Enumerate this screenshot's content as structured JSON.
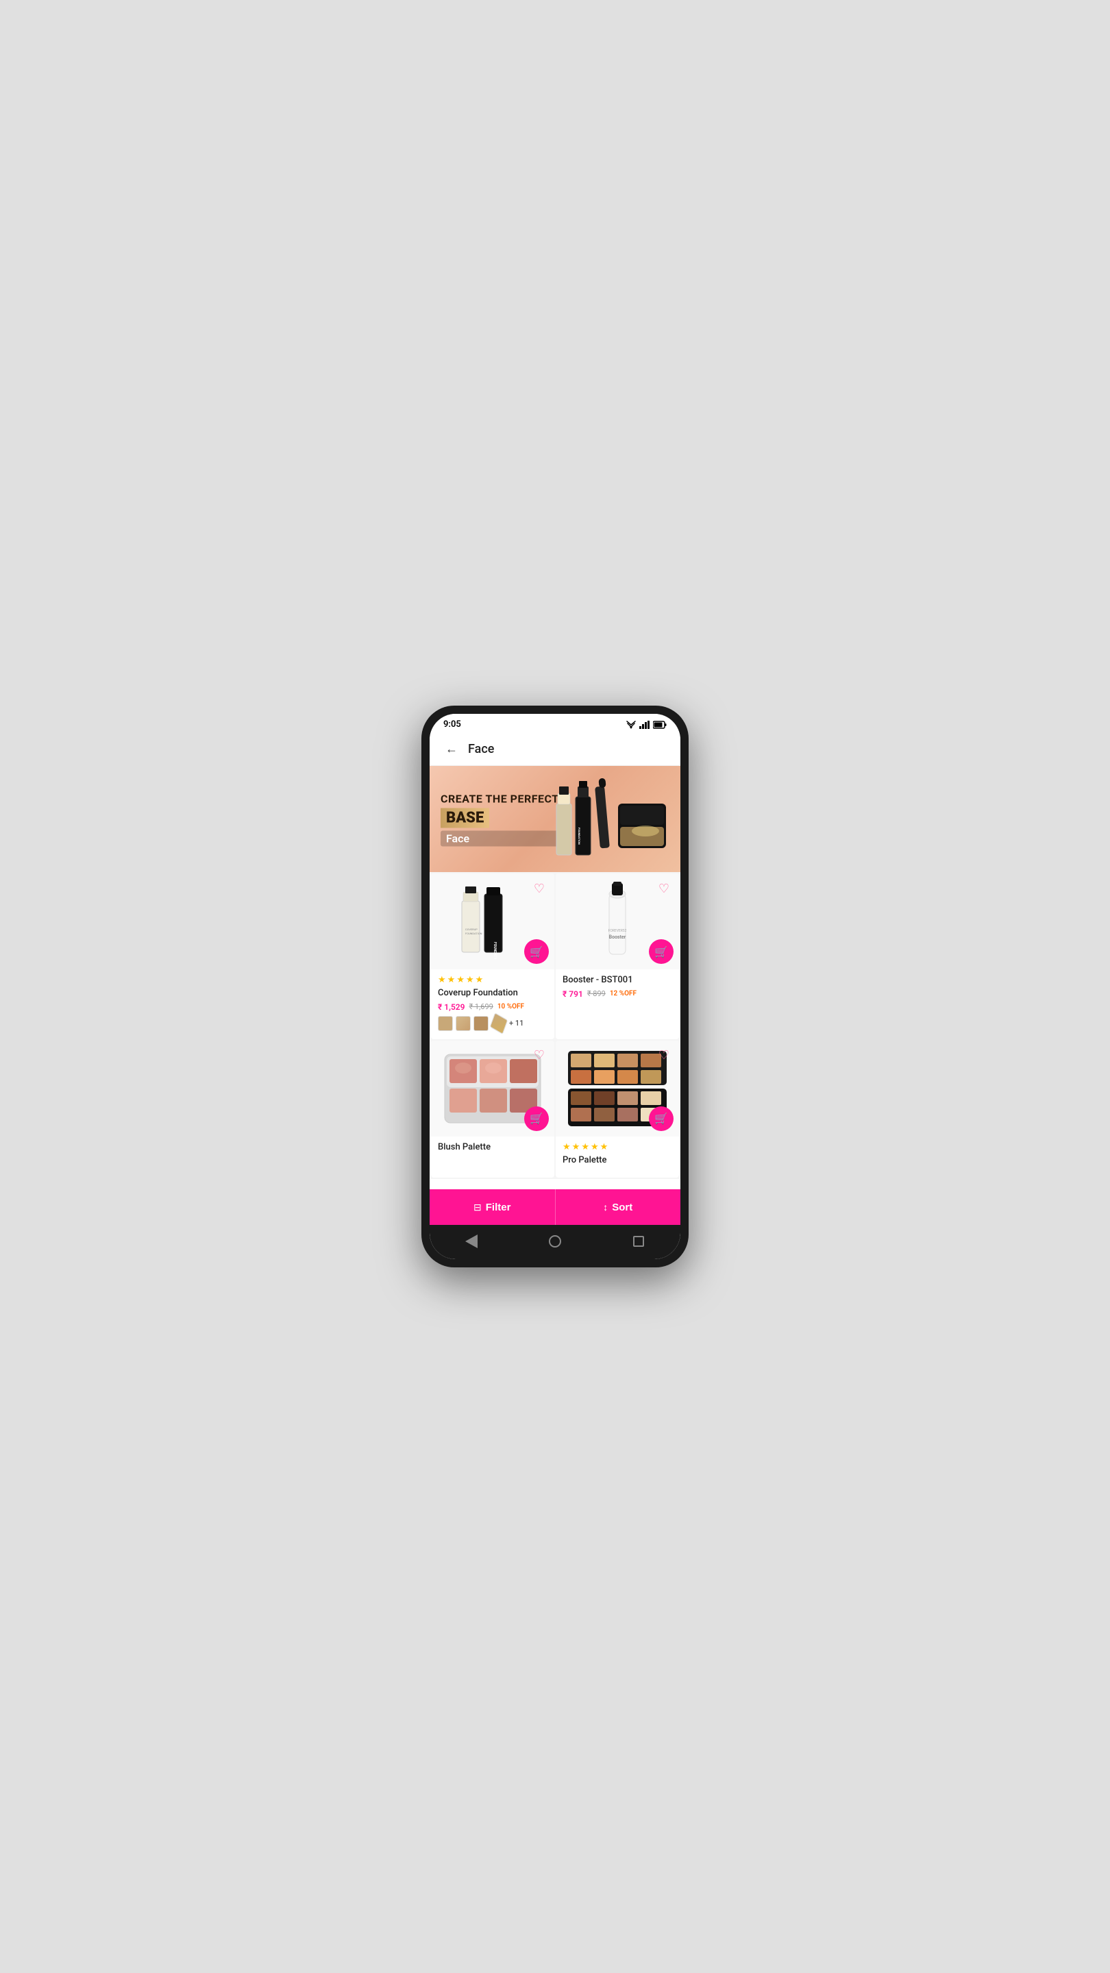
{
  "status_bar": {
    "time": "9:05"
  },
  "header": {
    "back_label": "←",
    "title": "Face"
  },
  "banner": {
    "line1": "CREATE THE PERFECT",
    "line2": "BASE",
    "category": "Face"
  },
  "products": [
    {
      "id": "p1",
      "name": "Coverup Foundation",
      "price_current": "₹ 1,529",
      "price_original": "₹ 1,699",
      "discount": "10 %OFF",
      "stars": 5,
      "has_swatches": true,
      "swatch_more": "+ 11",
      "type": "foundation"
    },
    {
      "id": "p2",
      "name": "Booster - BST001",
      "price_current": "₹ 791",
      "price_original": "₹ 899",
      "discount": "12 %OFF",
      "stars": 0,
      "has_swatches": false,
      "type": "booster"
    },
    {
      "id": "p3",
      "name": "Blush Palette",
      "price_current": "",
      "price_original": "",
      "discount": "",
      "stars": 0,
      "has_swatches": false,
      "type": "palette-blush"
    },
    {
      "id": "p4",
      "name": "Pro Palette",
      "price_current": "",
      "price_original": "",
      "discount": "",
      "stars": 5,
      "has_swatches": false,
      "type": "palette-pro"
    }
  ],
  "swatches": [
    {
      "color": "#c8a878"
    },
    {
      "color": "#d4b88a"
    },
    {
      "color": "#b89060"
    },
    {
      "color": "#c0a070"
    }
  ],
  "palette_blush_colors": [
    "#d4857a",
    "#e8a898",
    "#c07060",
    "#e0a090",
    "#d09080",
    "#b87068",
    "#c8887a",
    "#e0b0a0",
    "#d0988a"
  ],
  "palette_pro_colors": [
    "#d4a870",
    "#e0b878",
    "#c89060",
    "#b87848",
    "#c87040",
    "#d4884a",
    "#e0b060",
    "#c09858",
    "#885530",
    "#704028",
    "#c09070",
    "#e8d0a8",
    "#b07050",
    "#906040",
    "#a87060",
    "#f0e0c0"
  ],
  "bottom_bar": {
    "filter_label": "Filter",
    "sort_label": "Sort",
    "filter_icon": "⊟",
    "sort_icon": "↕"
  },
  "nav_bar": {
    "back": "back",
    "home": "home",
    "recent": "recent"
  }
}
